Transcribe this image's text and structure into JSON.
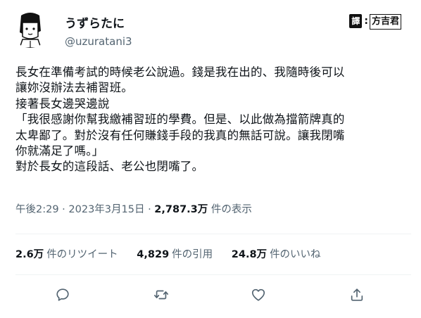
{
  "user": {
    "display_name": "うずらたに",
    "handle": "@uzuratani3"
  },
  "translator": {
    "badge": "譯",
    "separator": ":",
    "name": "方吉君"
  },
  "tweet": {
    "lines": [
      "長女在準備考試的時候老公說過。錢是我在出的、我隨時後可以",
      "讓妳沒辦法去補習班。",
      "接著長女邊哭邊說",
      "「我很感謝你幫我繳補習班的學費。但是、以此做為擋箭牌真的",
      "太卑鄙了。對於沒有任何賺錢手段的我真的無話可說。讓我閉嘴",
      "你就滿足了嗎。」",
      "對於長女的這段話、老公也閉嘴了。"
    ]
  },
  "meta": {
    "time": "午後2:29",
    "separator1": " · ",
    "date": "2023年3月15日",
    "separator2": " · ",
    "views": "2,787.3万",
    "views_label": "件の表示"
  },
  "stats": {
    "retweets": "2.6万",
    "retweets_label": "件のリツイート",
    "quotes": "4,829",
    "quotes_label": "件の引用",
    "likes": "24.8万",
    "likes_label": "件のいいね"
  },
  "actions": {
    "icons": [
      "reply-icon",
      "retweet-icon",
      "like-icon",
      "share-icon"
    ]
  },
  "colors": {
    "text": "#0f1419",
    "secondary": "#536471",
    "divider": "#eff3f4"
  }
}
